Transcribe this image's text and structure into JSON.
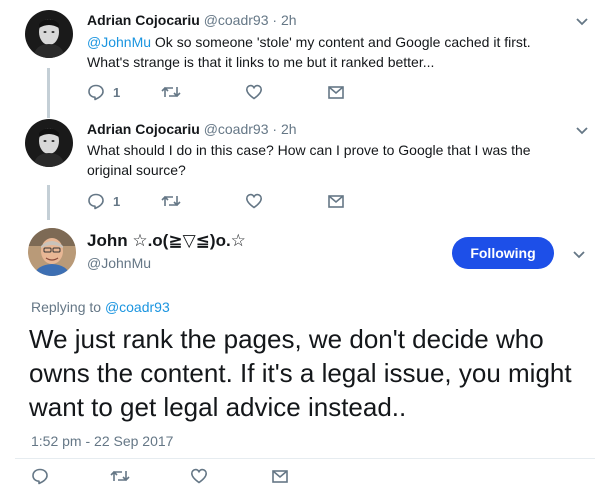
{
  "tweet1": {
    "name": "Adrian Cojocariu",
    "handle": "@coadr93",
    "separator": "·",
    "time": "2h",
    "mention": "@JohnMu",
    "text_line1": " Ok so someone 'stole' my content and Google cached it first.",
    "text_line2": "What's strange is that it links to me but it ranked better...",
    "reply_count": "1"
  },
  "tweet2": {
    "name": "Adrian Cojocariu",
    "handle": "@coadr93",
    "separator": "·",
    "time": "2h",
    "text_line1": "What should I do in this case? How can I prove to Google that I was the",
    "text_line2": "original source?",
    "reply_count": "1"
  },
  "main": {
    "name": "John ☆.o(≧▽≦)o.☆",
    "handle": "@JohnMu",
    "follow_label": "Following",
    "replying_prefix": "Replying to ",
    "replying_to": "@coadr93",
    "text": "We just rank the pages, we don't decide who owns the content. If it's a legal issue, you might want to get legal advice instead..",
    "timestamp": "1:52 pm - 22 Sep 2017"
  },
  "colors": {
    "accent": "#1b95e0",
    "button": "#1d4fe8",
    "muted": "#657786",
    "thread_line": "#c4cfd6"
  },
  "icons": [
    "reply-icon",
    "retweet-icon",
    "like-icon",
    "direct-message-icon",
    "chevron-down-icon"
  ]
}
